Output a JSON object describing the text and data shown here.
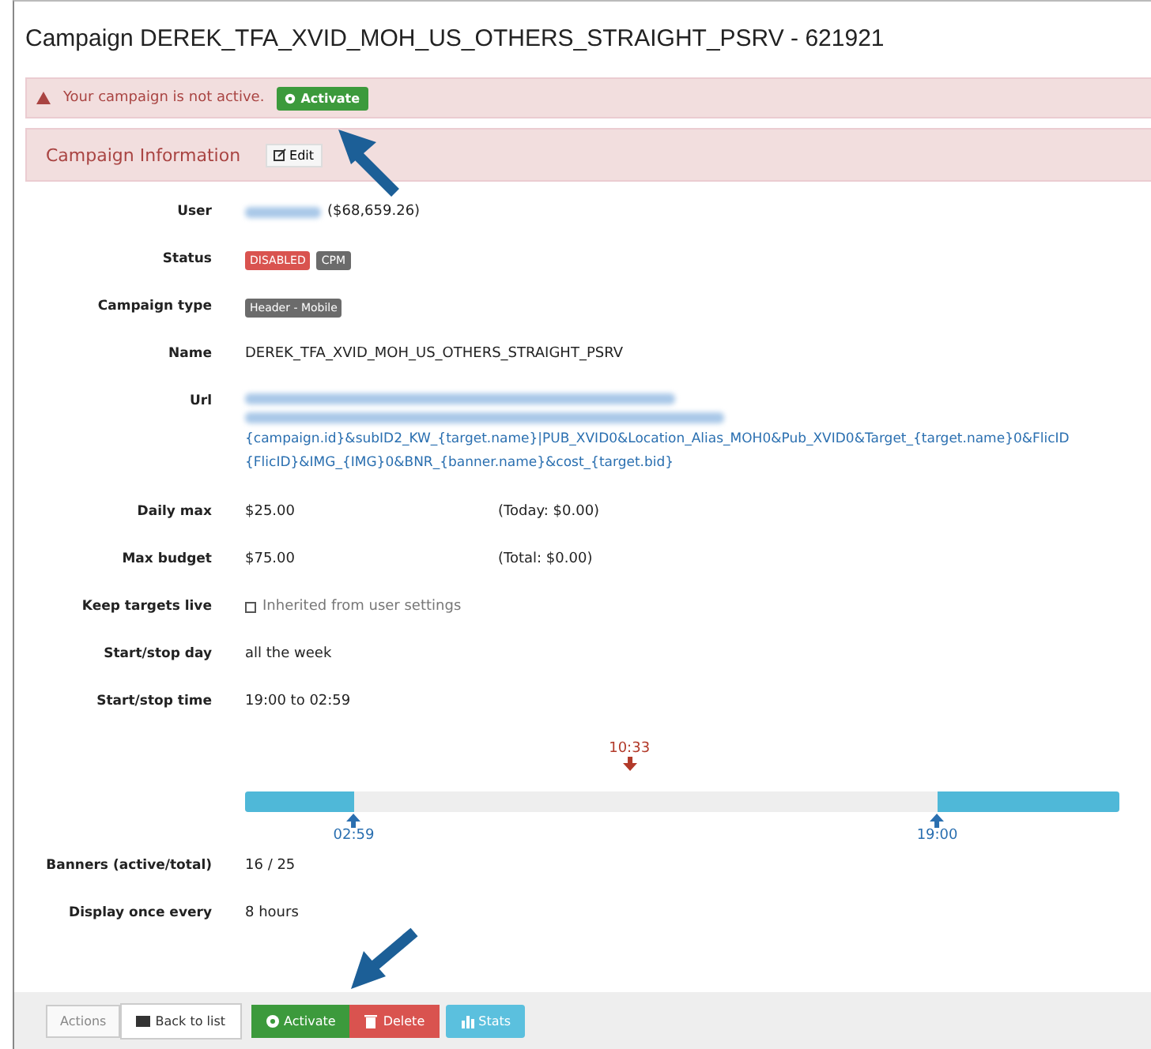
{
  "title": "Campaign DEREK_TFA_XVID_MOH_US_OTHERS_STRAIGHT_PSRV - 621921",
  "alert": {
    "text": "Your campaign is not active.",
    "button": "Activate"
  },
  "section": {
    "title": "Campaign Information",
    "edit_button": "Edit"
  },
  "fields": [
    {
      "kind": "user",
      "label": "User",
      "suffix": "($68,659.26)"
    },
    {
      "kind": "badges",
      "label": "Status",
      "badges": [
        {
          "text": "DISABLED",
          "color": "#d9534f"
        },
        {
          "text": "CPM",
          "color": "#6b6b6b"
        }
      ]
    },
    {
      "kind": "badges",
      "label": "Campaign type",
      "badges": [
        {
          "text": "Header - Mobile",
          "color": "#6b6b6b"
        }
      ]
    },
    {
      "kind": "text",
      "label": "Name",
      "value": "DEREK_TFA_XVID_MOH_US_OTHERS_STRAIGHT_PSRV"
    },
    {
      "kind": "url",
      "label": "Url",
      "lines": [
        "{campaign.id}&subID2_KW_{target.name}|PUB_XVID0&Location_Alias_MOH0&Pub_XVID0&Target_{target.name}0&FlicID",
        "{FlicID}&IMG_{IMG}0&BNR_{banner.name}&cost_{target.bid}"
      ]
    },
    {
      "kind": "pair",
      "label": "Daily max",
      "value": "$25.00",
      "extra": "(Today: $0.00)"
    },
    {
      "kind": "pair",
      "label": "Max budget",
      "value": "$75.00",
      "extra": "(Total: $0.00)"
    },
    {
      "kind": "check",
      "label": "Keep targets live",
      "value": "Inherited from user settings",
      "checked": false
    },
    {
      "kind": "text",
      "label": "Start/stop day",
      "value": "all the week"
    },
    {
      "kind": "text",
      "label": "Start/stop time",
      "value": "19:00 to 02:59"
    },
    {
      "kind": "timeline",
      "now": "10:33",
      "stop": "02:59",
      "start": "19:00"
    },
    {
      "kind": "text",
      "label": "Banners (active/total)",
      "value": "16 / 25"
    },
    {
      "kind": "text",
      "label": "Display once every",
      "value": "8 hours"
    }
  ],
  "footer": {
    "label": "Actions",
    "buttons": [
      {
        "kind": "back",
        "text": "Back to list"
      },
      {
        "kind": "activate",
        "text": "Activate"
      },
      {
        "kind": "delete",
        "text": "Delete"
      },
      {
        "kind": "stats",
        "text": "Stats"
      }
    ]
  }
}
